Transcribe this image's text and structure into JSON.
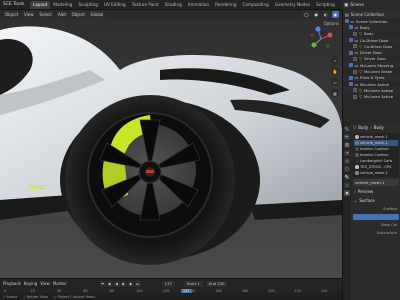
{
  "topbar": {
    "app_menu": "SCE Tools",
    "tabs": [
      "Layout",
      "Modeling",
      "Sculpting",
      "UV Editing",
      "Texture Paint",
      "Shading",
      "Animation",
      "Rendering",
      "Compositing",
      "Geometry Nodes",
      "Scripting"
    ],
    "active_tab": "Layout",
    "scene": "Scene"
  },
  "viewport": {
    "mode": "Object",
    "view": "View",
    "select": "Select",
    "add": "Add",
    "object": "Object",
    "orientation": "Global",
    "options": "Options",
    "badge_text": "765LT"
  },
  "timeline": {
    "playback": "Playback",
    "keying": "Keying",
    "view": "View",
    "marker": "Marker",
    "current_frame": "137",
    "start_label": "Start",
    "start": "1",
    "end_label": "End",
    "end": "250",
    "ruler_ticks": [
      "0",
      "20",
      "40",
      "60",
      "80",
      "100",
      "120",
      "140",
      "160",
      "180",
      "200",
      "220",
      "240"
    ],
    "cursor_frame": "137"
  },
  "statusbar": {
    "select": "Select",
    "rotate": "Rotate View",
    "context": "Object Context Menu"
  },
  "outliner": {
    "header": "Scene Collection",
    "items": [
      {
        "label": "Scene Collection",
        "indent": 0,
        "checked": true,
        "icon": "collection-icon",
        "color": "#e0e0e0"
      },
      {
        "label": "Body",
        "indent": 1,
        "checked": true,
        "icon": "collection-icon",
        "color": "#e0e0e0"
      },
      {
        "label": "Body",
        "indent": 2,
        "checked": false,
        "icon": "mesh-icon",
        "color": "#e89b3a"
      },
      {
        "label": "Co-Driver Door",
        "indent": 1,
        "checked": true,
        "icon": "collection-icon",
        "color": "#e0e0e0"
      },
      {
        "label": "Co-Driver Door",
        "indent": 2,
        "checked": false,
        "icon": "mesh-icon",
        "color": "#e89b3a"
      },
      {
        "label": "Driver Door",
        "indent": 1,
        "checked": true,
        "icon": "collection-icon",
        "color": "#e0e0e0"
      },
      {
        "label": "Driver Door",
        "indent": 2,
        "checked": false,
        "icon": "mesh-icon",
        "color": "#e89b3a"
      },
      {
        "label": "McLaren Steering",
        "indent": 1,
        "checked": true,
        "icon": "collection-icon",
        "color": "#e0e0e0"
      },
      {
        "label": "McLaren Brake",
        "indent": 2,
        "checked": false,
        "icon": "mesh-icon",
        "color": "#e89b3a"
      },
      {
        "label": "Rims & Tyres",
        "indent": 1,
        "checked": true,
        "icon": "collection-icon",
        "color": "#e0e0e0"
      },
      {
        "label": "McLaren Active",
        "indent": 1,
        "checked": true,
        "icon": "collection-icon",
        "color": "#e0e0e0"
      },
      {
        "label": "McLaren Active",
        "indent": 2,
        "checked": false,
        "icon": "mesh-icon",
        "color": "#e89b3a"
      },
      {
        "label": "McLaren Active",
        "indent": 2,
        "checked": false,
        "icon": "mesh-icon",
        "color": "#e89b3a"
      }
    ]
  },
  "properties": {
    "object_name": "Body",
    "mesh_name": "Body",
    "slots": [
      {
        "label": "vehicle_mesh.1",
        "color": "#b8b8b8",
        "active": false
      },
      {
        "label": "vehicle_mesh.1",
        "color": "#777777",
        "active": true
      },
      {
        "label": "Interior Cushion",
        "color": "#4a4a4a",
        "active": false
      },
      {
        "label": "Interior Cushion",
        "color": "#5a5a5a",
        "active": false
      },
      {
        "label": "Lamborghini Carb",
        "color": "#333333",
        "active": false
      },
      {
        "label": "TEX_STROS - CPS",
        "color": "#c2c2c2",
        "active": false
      },
      {
        "label": "vehicle_mesh.1",
        "color": "#888888",
        "active": false
      }
    ],
    "material_field": "vehicle_mesh.1",
    "sections": [
      "Preview",
      "Surface"
    ],
    "rows": [
      "Surface",
      "Base Col",
      "Subsurface"
    ]
  },
  "colors": {
    "accent": "#4772b3",
    "brake_caliper": "#c8e629",
    "body_paint": "#dfe3e7"
  }
}
